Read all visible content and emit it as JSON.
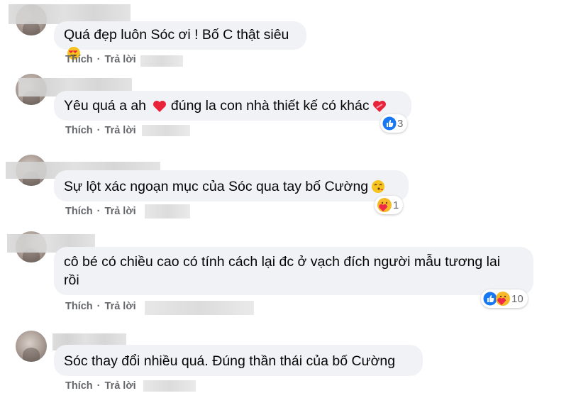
{
  "actions": {
    "like": "Thích",
    "reply": "Trả lời",
    "separator": "·"
  },
  "comments": [
    {
      "text": "Quá đẹp luôn Sóc ơi ! Bố C thật siêu",
      "emoji": "heart-eyes-emoji",
      "reaction_count": null
    },
    {
      "text": "Yêu quá a ah",
      "text_after": "đúng la con nhà thiết kế có khác",
      "emoji": "red-heart-emoji",
      "emoji_end": "heart-ribbon-emoji",
      "reaction_count": "3",
      "reaction_icons": [
        "like-reaction-icon"
      ]
    },
    {
      "text": "Sự lột xác ngoạn mục của Sóc qua tay bố Cường",
      "emoji": "kiss-emoji",
      "reaction_count": "1",
      "reaction_icons": [
        "care-reaction-icon"
      ]
    },
    {
      "text_line1": "cô bé có chiều cao có tính cách lại đc ở vạch đích người mẫu tương lai",
      "text_line2": "rồi",
      "reaction_count": "10",
      "reaction_icons": [
        "like-reaction-icon",
        "care-reaction-icon"
      ]
    },
    {
      "text": "Sóc thay đổi nhiều quá. Đúng thần thái của bố Cường",
      "reaction_count": null
    }
  ],
  "colors": {
    "bubble": "#f0f2f5",
    "text": "#050505",
    "action": "#65676b",
    "like_blue": "#1877f2",
    "care_yellow": "#f7b928",
    "heart_red": "#f02849"
  }
}
